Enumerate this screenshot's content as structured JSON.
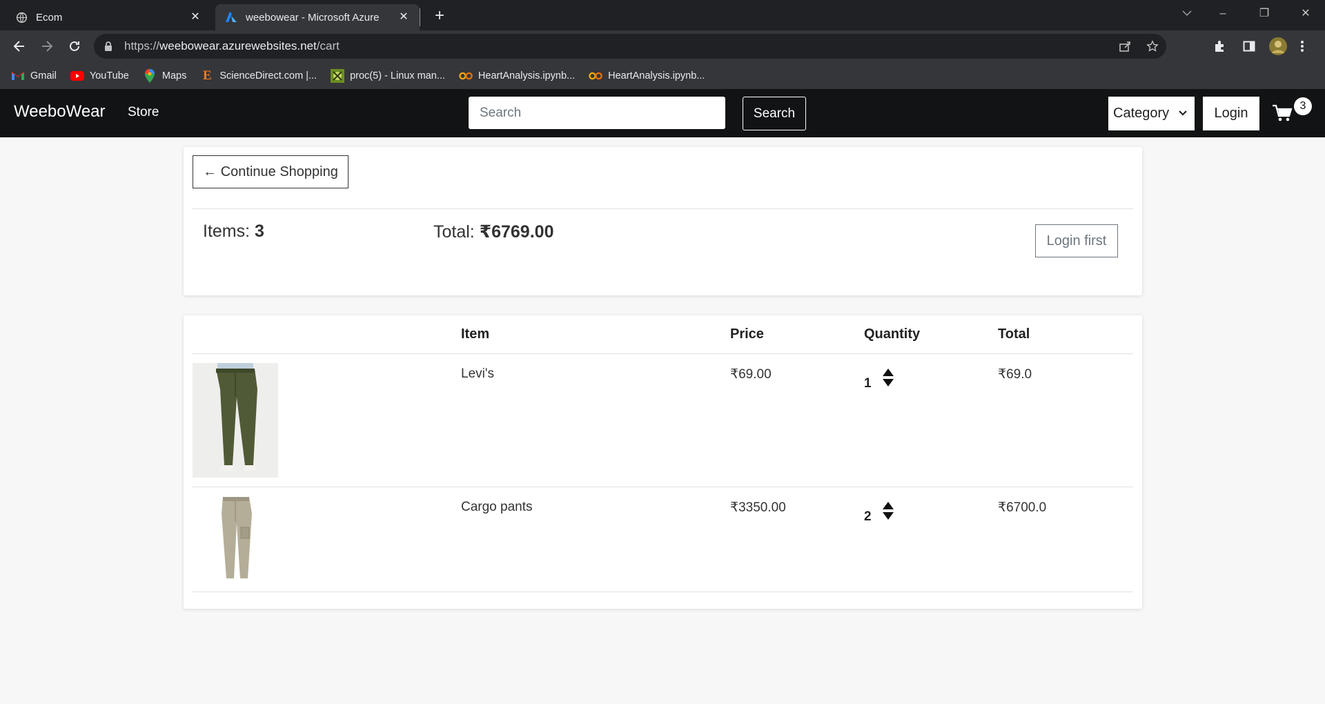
{
  "browser": {
    "tabs": [
      {
        "title": "Ecom",
        "active": false
      },
      {
        "title": "weebowear - Microsoft Azure",
        "active": true
      }
    ],
    "url": {
      "scheme": "https://",
      "host": "weebowear.azurewebsites.net",
      "path": "/cart"
    },
    "bookmarks": [
      {
        "label": "Gmail",
        "icon": "gmail-icon"
      },
      {
        "label": "YouTube",
        "icon": "youtube-icon"
      },
      {
        "label": "Maps",
        "icon": "maps-icon"
      },
      {
        "label": "ScienceDirect.com |...",
        "icon": "elsevier-icon"
      },
      {
        "label": "proc(5) - Linux man...",
        "icon": "linux-icon"
      },
      {
        "label": "HeartAnalysis.ipynb...",
        "icon": "colab-icon"
      },
      {
        "label": "HeartAnalysis.ipynb...",
        "icon": "colab-icon"
      }
    ]
  },
  "site": {
    "brand": "WeeboWear",
    "nav_store": "Store",
    "search_placeholder": "Search",
    "search_button": "Search",
    "category_label": "Category",
    "login_button": "Login",
    "cart_count": "3"
  },
  "summary": {
    "continue_label": "← Continue Shopping",
    "items_label": "Items: ",
    "items_count": "3",
    "total_label": "Total: ",
    "total_value": "₹6769.00",
    "checkout_label": "Login first"
  },
  "table": {
    "headers": [
      "Item",
      "Price",
      "Quantity",
      "Total"
    ],
    "rows": [
      {
        "item": "Levi's",
        "price": "₹69.00",
        "quantity": "1",
        "total": "₹69.0",
        "image": "olive-trousers"
      },
      {
        "item": "Cargo pants",
        "price": "₹3350.00",
        "quantity": "2",
        "total": "₹6700.0",
        "image": "khaki-cargo-pants"
      }
    ]
  },
  "colors": {
    "navbar": "#111314",
    "page_bg": "#f7f7f7",
    "chrome_bg": "#35363a",
    "tabstrip_bg": "#202124"
  }
}
